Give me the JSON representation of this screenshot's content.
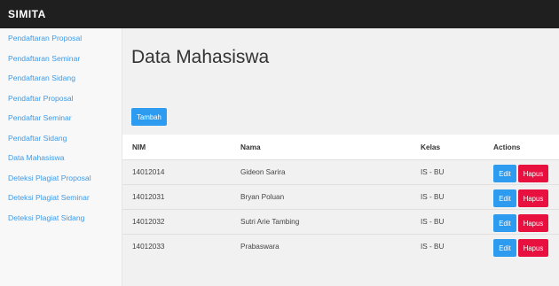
{
  "app": {
    "brand": "SIMITA"
  },
  "sidebar": {
    "items": [
      {
        "label": "Pendaftaran Proposal"
      },
      {
        "label": "Pendaftaran Seminar"
      },
      {
        "label": "Pendaftaran Sidang"
      },
      {
        "label": "Pendaftar Proposal"
      },
      {
        "label": "Pendaftar Seminar"
      },
      {
        "label": "Pendaftar Sidang"
      },
      {
        "label": "Data Mahasiswa"
      },
      {
        "label": "Deteksi Plagiat Proposal"
      },
      {
        "label": "Deteksi Plagiat Seminar"
      },
      {
        "label": "Deteksi Plagiat Sidang"
      }
    ]
  },
  "main": {
    "title": "Data Mahasiswa",
    "add_label": "Tambah",
    "table": {
      "headers": [
        "NIM",
        "Nama",
        "Kelas",
        "Actions"
      ],
      "rows": [
        {
          "nim": "14012014",
          "nama": "Gideon Sarira",
          "kelas": "IS - BU"
        },
        {
          "nim": "14012031",
          "nama": "Bryan Poluan",
          "kelas": "IS - BU"
        },
        {
          "nim": "14012032",
          "nama": "Sutri Arie Tambing",
          "kelas": "IS - BU"
        },
        {
          "nim": "14012033",
          "nama": "Prabaswara",
          "kelas": "IS - BU"
        }
      ],
      "edit_label": "Edit",
      "delete_label": "Hapus"
    }
  },
  "colors": {
    "topbar": "#1f1f1f",
    "link": "#3d9be9",
    "primary": "#2d9cf0",
    "danger": "#e8103f",
    "main_bg": "#f1f1f1"
  }
}
